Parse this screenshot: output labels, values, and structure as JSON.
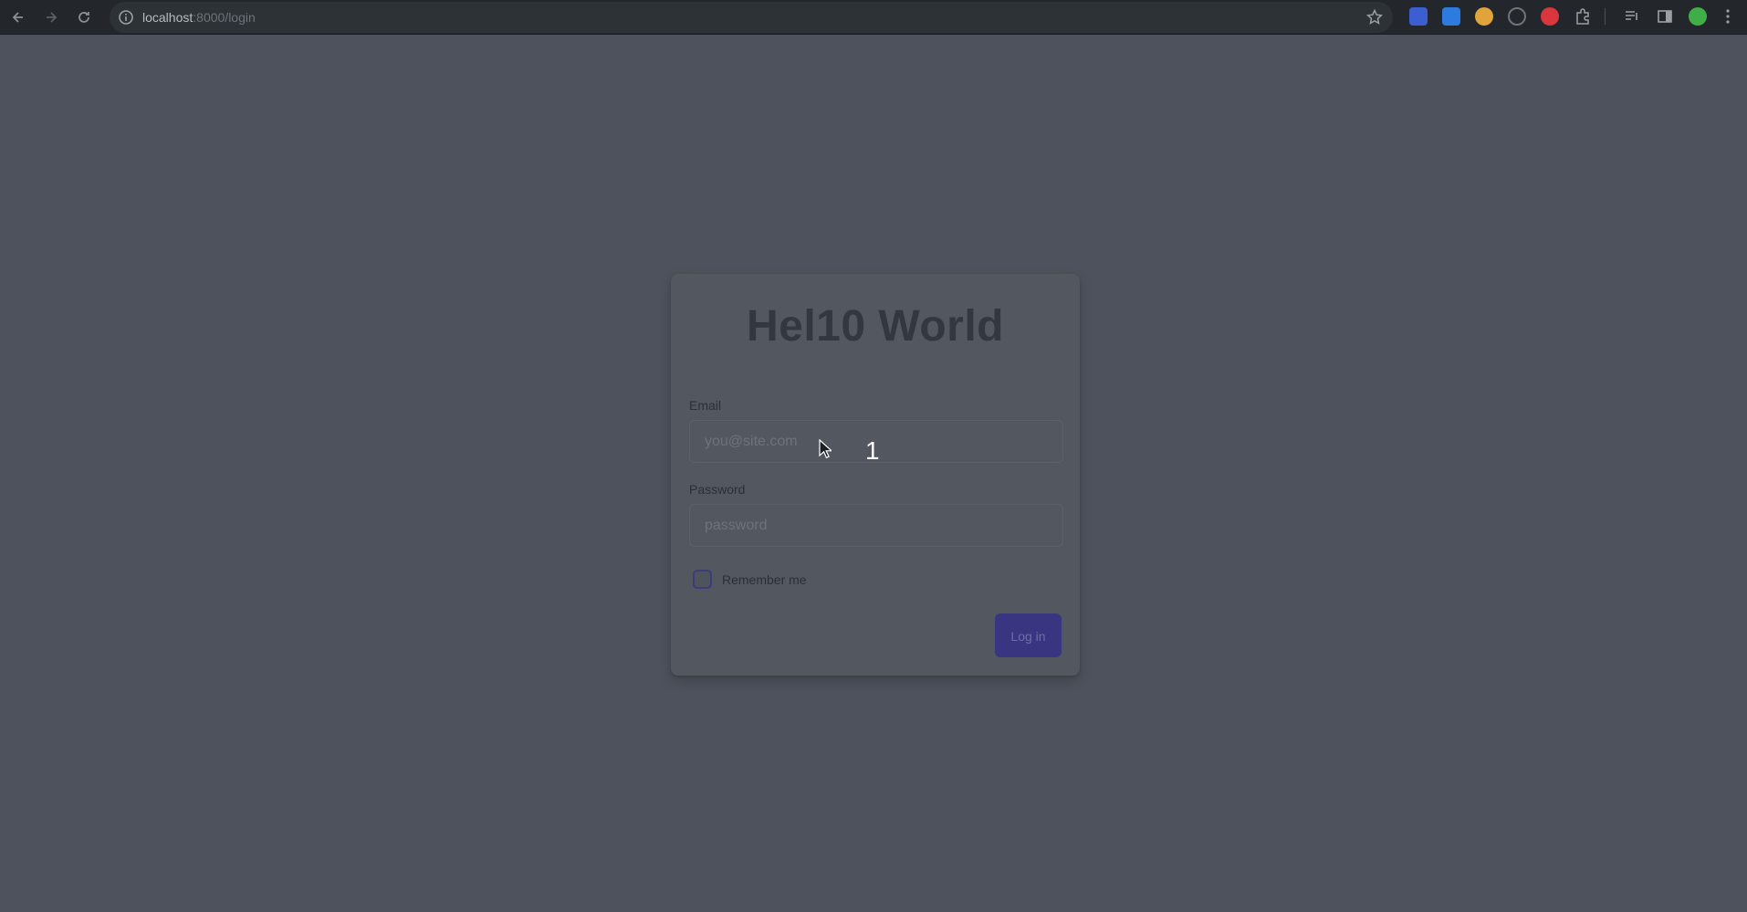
{
  "browser": {
    "url_host": "localhost",
    "url_rest": ":8000/login",
    "nav": {
      "back_icon": "back-arrow-icon",
      "forward_icon": "forward-arrow-icon",
      "reload_icon": "reload-icon"
    },
    "extension_colors": [
      "#3b5fd0",
      "#2e7be0",
      "#e0a43a",
      "#6f747b",
      "#d9363e",
      "#9aa0a6",
      "#9aa0a6",
      "#9aa0a6",
      "#3fae49"
    ]
  },
  "login": {
    "title": "Hel10 World",
    "email_label": "Email",
    "email_placeholder": "you@site.com",
    "password_label": "Password",
    "password_placeholder": "password",
    "remember_label": "Remember me",
    "login_button": "Log in"
  },
  "overlay": {
    "step_number": "1"
  },
  "colors": {
    "page_background": "#4e525c",
    "card_background": "#53575f",
    "button_accent": "#3a3580"
  }
}
